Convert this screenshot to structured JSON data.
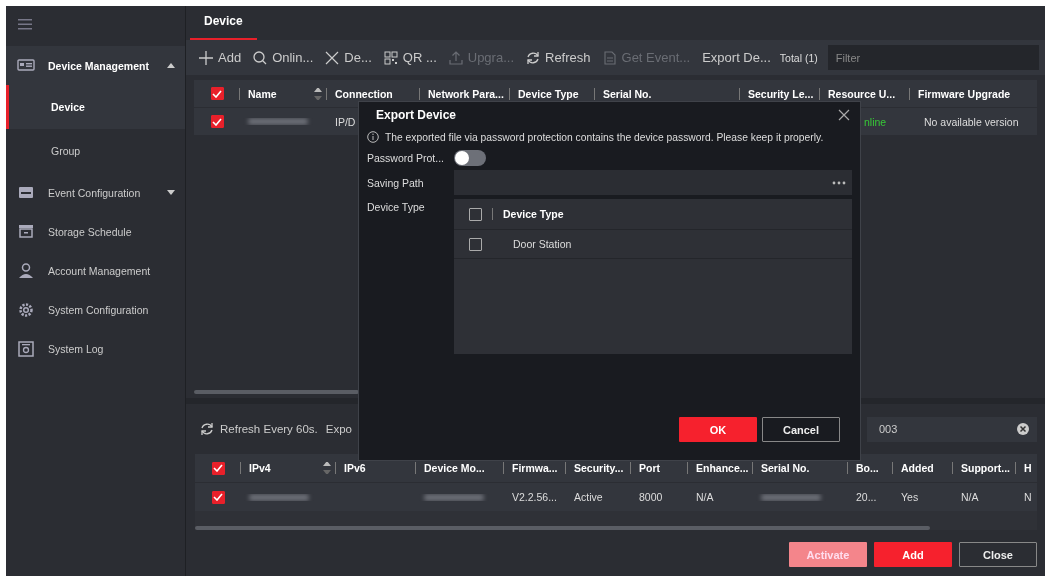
{
  "sidebar": {
    "items": [
      {
        "label": "Device Management",
        "selected": false,
        "expanded": true,
        "children": [
          {
            "label": "Device",
            "selected": true
          },
          {
            "label": "Group",
            "selected": false
          }
        ]
      },
      {
        "label": "Event Configuration",
        "selected": false,
        "expanded": false
      },
      {
        "label": "Storage Schedule",
        "selected": false
      },
      {
        "label": "Account Management",
        "selected": false
      },
      {
        "label": "System Configuration",
        "selected": false
      },
      {
        "label": "System Log",
        "selected": false
      }
    ]
  },
  "tabs": [
    {
      "label": "Device",
      "selected": true
    }
  ],
  "toolbar": {
    "buttons": [
      {
        "label": "Add",
        "disabled": false
      },
      {
        "label": "Onlin...",
        "disabled": false
      },
      {
        "label": "De...",
        "disabled": false
      },
      {
        "label": "QR ...",
        "disabled": false
      },
      {
        "label": "Upgra...",
        "disabled": true
      },
      {
        "label": "Refresh",
        "disabled": false
      },
      {
        "label": "Get Event...",
        "disabled": true
      },
      {
        "label": "Export De...",
        "disabled": false
      }
    ],
    "total": "Total (1)",
    "filter": {
      "placeholder": "Filter"
    }
  },
  "device_table": {
    "all_checked": true,
    "columns": [
      "Name",
      "Connection",
      "Network Para...",
      "Device Type",
      "Serial No.",
      "Security Le...",
      "Resource U...",
      "Firmware Upgrade"
    ],
    "rows": [
      {
        "checked": true,
        "cells": [
          {
            "kind": "blur"
          },
          {
            "kind": "text",
            "text": "IP/D"
          },
          {
            "kind": "empty"
          },
          {
            "kind": "empty"
          },
          {
            "kind": "empty"
          },
          {
            "kind": "empty"
          },
          {
            "kind": "status",
            "text": "nline"
          },
          {
            "kind": "text",
            "text": "No available version"
          }
        ]
      }
    ]
  },
  "online_panel": {
    "refresh": "Refresh Every 60s.",
    "export": "Expo",
    "search_value": "003",
    "table": {
      "all_checked": true,
      "columns": [
        "IPv4",
        "IPv6",
        "Device Mo...",
        "Firmwa...",
        "Security...",
        "Port",
        "Enhance...",
        "Serial No.",
        "Bo...",
        "Added",
        "Support...",
        "H"
      ],
      "rows": [
        {
          "checked": true,
          "cells": [
            {
              "kind": "blur"
            },
            {
              "kind": "empty"
            },
            {
              "kind": "blur"
            },
            {
              "kind": "text",
              "text": "V2.2.56..."
            },
            {
              "kind": "text",
              "text": "Active"
            },
            {
              "kind": "text",
              "text": "8000"
            },
            {
              "kind": "text",
              "text": "N/A"
            },
            {
              "kind": "blur"
            },
            {
              "kind": "text",
              "text": "20..."
            },
            {
              "kind": "text",
              "text": "Yes"
            },
            {
              "kind": "text",
              "text": "N/A"
            },
            {
              "kind": "text",
              "text": "N"
            }
          ]
        }
      ]
    },
    "buttons": [
      {
        "label": "Activate",
        "kind": "primary",
        "disabled": true
      },
      {
        "label": "Add",
        "kind": "primary",
        "disabled": false
      },
      {
        "label": "Close",
        "kind": "secondary",
        "disabled": false
      }
    ]
  },
  "dialog": {
    "title": "Export Device",
    "notice": "The exported file via password protection contains the device password. Please keep it properly.",
    "password_label": "Password Prot...",
    "password_on": false,
    "saving_path_label": "Saving Path",
    "device_type_label": "Device Type",
    "type_table": {
      "all_checked": false,
      "column": "Device Type",
      "rows": [
        {
          "label": "Door Station",
          "checked": false
        }
      ]
    },
    "buttons": [
      {
        "label": "OK",
        "kind": "primary"
      },
      {
        "label": "Cancel",
        "kind": "secondary"
      }
    ]
  }
}
